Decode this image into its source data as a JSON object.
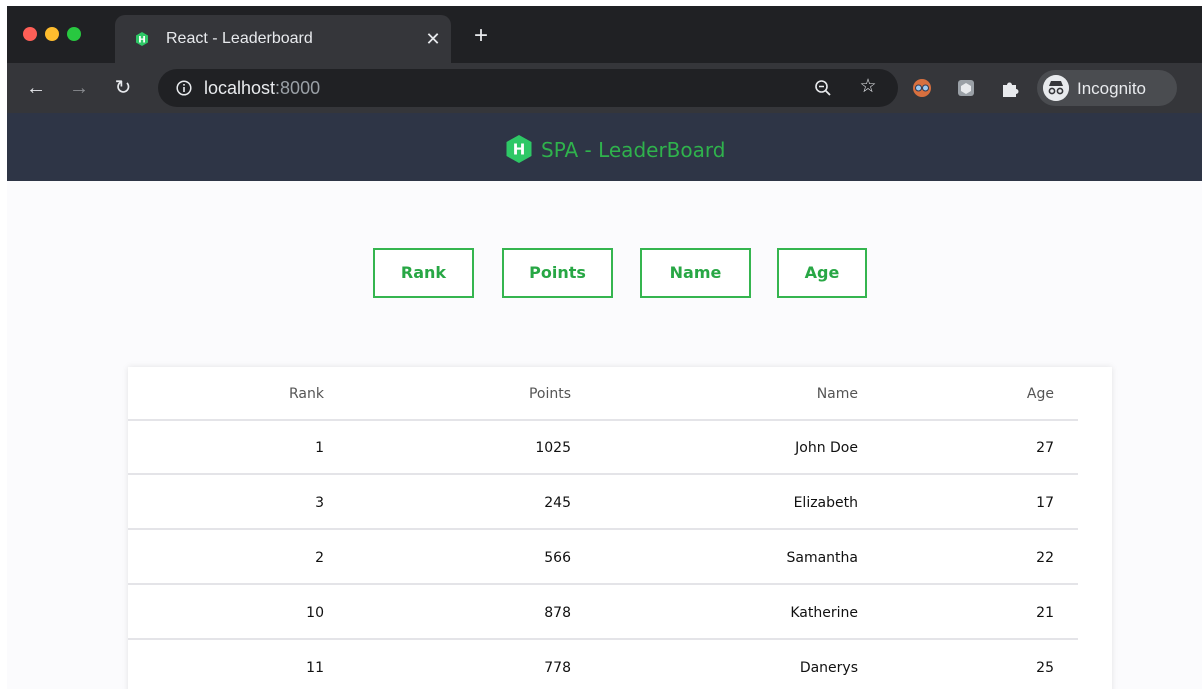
{
  "browser": {
    "tab_title": "React - Leaderboard",
    "tab_favicon_letter": "H",
    "new_tab_symbol": "+",
    "url_host": "localhost",
    "url_port": ":8000",
    "profile_label": "Incognito"
  },
  "app": {
    "brand_letter": "H",
    "title": "SPA - LeaderBoard",
    "accent_color": "#2fb24c",
    "header_color": "#2e3546"
  },
  "sort_buttons": {
    "rank": "Rank",
    "points": "Points",
    "name": "Name",
    "age": "Age"
  },
  "table": {
    "columns": [
      "Rank",
      "Points",
      "Name",
      "Age"
    ],
    "rows": [
      {
        "rank": "1",
        "points": "1025",
        "name": "John Doe",
        "age": "27"
      },
      {
        "rank": "3",
        "points": "245",
        "name": "Elizabeth",
        "age": "17"
      },
      {
        "rank": "2",
        "points": "566",
        "name": "Samantha",
        "age": "22"
      },
      {
        "rank": "10",
        "points": "878",
        "name": "Katherine",
        "age": "21"
      },
      {
        "rank": "11",
        "points": "778",
        "name": "Danerys",
        "age": "25"
      }
    ]
  },
  "icons": [
    "back-arrow-icon",
    "forward-arrow-icon",
    "reload-icon",
    "info-icon",
    "zoom-icon",
    "star-icon",
    "extension-icon",
    "puzzle-icon",
    "incognito-icon",
    "more-menu-icon",
    "close-icon"
  ]
}
